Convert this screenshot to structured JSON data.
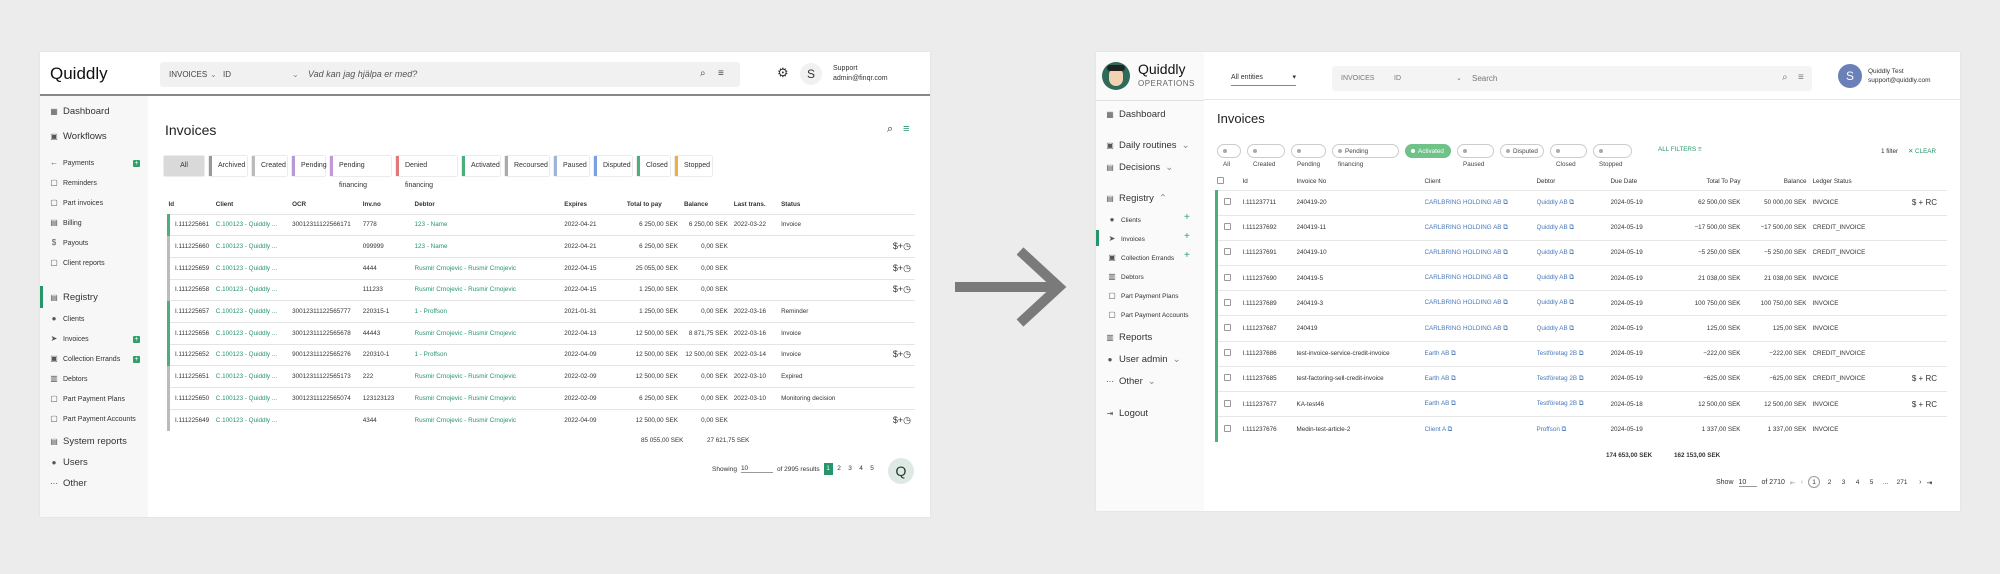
{
  "left": {
    "logo": "Quiddly",
    "search": {
      "type": "INVOICES",
      "field": "ID",
      "placeholder": "Vad kan jag hjälpa er med?"
    },
    "user": {
      "initial": "S",
      "name": "Support",
      "email": "admin@finqr.com"
    },
    "nav": {
      "dashboard": "Dashboard",
      "workflows": "Workflows",
      "payments": "Payments",
      "reminders": "Reminders",
      "part_invoices": "Part invoices",
      "billing": "Billing",
      "payouts": "Payouts",
      "client_reports": "Client reports",
      "registry": "Registry",
      "clients": "Clients",
      "invoices": "Invoices",
      "collection_errands": "Collection Errands",
      "debtors": "Debtors",
      "part_payment_plans": "Part Payment Plans",
      "part_payment_accounts": "Part Payment Accounts",
      "system_reports": "System reports",
      "users": "Users",
      "other": "Other"
    },
    "title": "Invoices",
    "filters": [
      "All",
      "Archived",
      "Created",
      "Pending",
      "Pending financing",
      "Denied financing",
      "Activated",
      "Recoursed",
      "Paused",
      "Disputed",
      "Closed",
      "Stopped"
    ],
    "filter_colors": [
      "#bbbbbb",
      "#999999",
      "#bbbbbb",
      "#b59ad6",
      "#c49ad6",
      "#e07a7a",
      "#4cae7a",
      "#aaaaaa",
      "#a0b4d6",
      "#7aa0e0",
      "#4cae7a",
      "#f0b040"
    ],
    "columns": [
      "Id",
      "Client",
      "OCR",
      "Inv.no",
      "Debtor",
      "Expires",
      "Total to pay",
      "Balance",
      "Last trans.",
      "Status"
    ],
    "rows": [
      {
        "id": "I.111225661",
        "client": "C.100123 - Quiddly ...",
        "ocr": "30012311122566171",
        "inv": "7778",
        "debtor": "123 - Name",
        "expires": "2022-04-21",
        "total": "6 250,00 SEK",
        "balance": "6 250,00 SEK",
        "last": "2022-03-22",
        "status": "Invoice",
        "actions": ""
      },
      {
        "id": "I.111225660",
        "client": "C.100123 - Quiddly ...",
        "ocr": "",
        "inv": "099999",
        "debtor": "123 - Name",
        "expires": "2022-04-21",
        "total": "6 250,00 SEK",
        "balance": "0,00 SEK",
        "last": "",
        "status": "",
        "actions": "$+◷"
      },
      {
        "id": "I.111225659",
        "client": "C.100123 - Quiddly ...",
        "ocr": "",
        "inv": "4444",
        "debtor": "Rusmir Crnojevic - Rusmir Crnojevic",
        "expires": "2022-04-15",
        "total": "25 055,00 SEK",
        "balance": "0,00 SEK",
        "last": "",
        "status": "",
        "actions": "$+◷"
      },
      {
        "id": "I.111225658",
        "client": "C.100123 - Quiddly ...",
        "ocr": "",
        "inv": "111233",
        "debtor": "Rusmir Crnojevic - Rusmir Crnojevic",
        "expires": "2022-04-15",
        "total": "1 250,00 SEK",
        "balance": "0,00 SEK",
        "last": "",
        "status": "",
        "actions": "$+◷"
      },
      {
        "id": "I.111225657",
        "client": "C.100123 - Quiddly ...",
        "ocr": "30012311122565777",
        "inv": "220315-1",
        "debtor": "1 - Proffson",
        "expires": "2021-01-31",
        "total": "1 250,00 SEK",
        "balance": "0,00 SEK",
        "last": "2022-03-16",
        "status": "Reminder",
        "actions": ""
      },
      {
        "id": "I.111225656",
        "client": "C.100123 - Quiddly ...",
        "ocr": "30012311122565678",
        "inv": "44443",
        "debtor": "Rusmir Crnojevic - Rusmir Crnojevic",
        "expires": "2022-04-13",
        "total": "12 500,00 SEK",
        "balance": "8 871,75 SEK",
        "last": "2022-03-16",
        "status": "Invoice",
        "actions": ""
      },
      {
        "id": "I.111225652",
        "client": "C.100123 - Quiddly ...",
        "ocr": "90012311122565276",
        "inv": "220310-1",
        "debtor": "1 - Proffson",
        "expires": "2022-04-09",
        "total": "12 500,00 SEK",
        "balance": "12 500,00 SEK",
        "last": "2022-03-14",
        "status": "Invoice",
        "actions": "$+◷"
      },
      {
        "id": "I.111225651",
        "client": "C.100123 - Quiddly ...",
        "ocr": "30012311122565173",
        "inv": "222",
        "debtor": "Rusmir Crnojevic - Rusmir Crnojevic",
        "expires": "2022-02-09",
        "total": "12 500,00 SEK",
        "balance": "0,00 SEK",
        "last": "2022-03-10",
        "status": "Expired",
        "actions": ""
      },
      {
        "id": "I.111225650",
        "client": "C.100123 - Quiddly ...",
        "ocr": "30012311122565074",
        "inv": "123123123",
        "debtor": "Rusmir Crnojevic - Rusmir Crnojevic",
        "expires": "2022-02-09",
        "total": "6 250,00 SEK",
        "balance": "0,00 SEK",
        "last": "2022-03-10",
        "status": "Monitoring decision",
        "actions": ""
      },
      {
        "id": "I.111225649",
        "client": "C.100123 - Quiddly ...",
        "ocr": "",
        "inv": "4344",
        "debtor": "Rusmir Crnojevic - Rusmir Crnojevic",
        "expires": "2022-04-09",
        "total": "12 500,00 SEK",
        "balance": "0,00 SEK",
        "last": "",
        "status": "",
        "actions": "$+◷"
      }
    ],
    "totals": {
      "total": "85 055,00 SEK",
      "balance": "27 621,75 SEK"
    },
    "pagination": {
      "showing": "Showing",
      "per_page": "10",
      "of": "of 2995 results",
      "pages": [
        "1",
        "2",
        "3",
        "4",
        "5"
      ]
    }
  },
  "right": {
    "logo": "Quiddly",
    "logo_sub": "OPERATIONS",
    "entities": "All entities",
    "search": {
      "type": "INVOICES",
      "field": "ID",
      "placeholder": "Search"
    },
    "user": {
      "initial": "S",
      "name": "Quiddly Test",
      "email": "support@quiddly.com"
    },
    "nav": {
      "dashboard": "Dashboard",
      "daily_routines": "Daily routines",
      "decisions": "Decisions",
      "registry": "Registry",
      "clients": "Clients",
      "invoices": "Invoices",
      "collection_errands": "Collection Errands",
      "debtors": "Debtors",
      "part_payment_plans": "Part Payment Plans",
      "part_payment_accounts": "Part Payment Accounts",
      "reports": "Reports",
      "user_admin": "User admin",
      "other": "Other",
      "logout": "Logout"
    },
    "title": "Invoices",
    "chips": [
      "All",
      "Created",
      "Pending",
      "Pending financing",
      "Activated",
      "Paused",
      "Disputed",
      "Closed",
      "Stopped"
    ],
    "all_filters": "ALL FILTERS",
    "filter_count": "1 filter",
    "clear": "CLEAR",
    "columns": [
      "Id",
      "Invoice No",
      "Client",
      "Debtor",
      "Due Date",
      "Total To Pay",
      "Balance",
      "Ledger Status"
    ],
    "rows": [
      {
        "id": "I.111237711",
        "no": "240419-20",
        "client": "CARLBRING HOLDING AB",
        "debtor": "Quiddly AB",
        "due": "2024-05-19",
        "total": "62 500,00 SEK",
        "balance": "50 000,00 SEK",
        "status": "INVOICE",
        "actions": "$ + RC"
      },
      {
        "id": "I.111237692",
        "no": "240419-11",
        "client": "CARLBRING HOLDING AB",
        "debtor": "Quiddly AB",
        "due": "2024-05-19",
        "total": "−17 500,00 SEK",
        "balance": "−17 500,00 SEK",
        "status": "CREDIT_INVOICE",
        "actions": ""
      },
      {
        "id": "I.111237691",
        "no": "240419-10",
        "client": "CARLBRING HOLDING AB",
        "debtor": "Quiddly AB",
        "due": "2024-05-19",
        "total": "−5 250,00 SEK",
        "balance": "−5 250,00 SEK",
        "status": "CREDIT_INVOICE",
        "actions": ""
      },
      {
        "id": "I.111237690",
        "no": "240419-5",
        "client": "CARLBRING HOLDING AB",
        "debtor": "Quiddly AB",
        "due": "2024-05-19",
        "total": "21 038,00 SEK",
        "balance": "21 038,00 SEK",
        "status": "INVOICE",
        "actions": ""
      },
      {
        "id": "I.111237689",
        "no": "240419-3",
        "client": "CARLBRING HOLDING AB",
        "debtor": "Quiddly AB",
        "due": "2024-05-19",
        "total": "100 750,00 SEK",
        "balance": "100 750,00 SEK",
        "status": "INVOICE",
        "actions": ""
      },
      {
        "id": "I.111237687",
        "no": "240419",
        "client": "CARLBRING HOLDING AB",
        "debtor": "Quiddly AB",
        "due": "2024-05-19",
        "total": "125,00 SEK",
        "balance": "125,00 SEK",
        "status": "INVOICE",
        "actions": ""
      },
      {
        "id": "I.111237686",
        "no": "test-invoice-service-credit-invoice",
        "client": "Earth AB",
        "debtor": "Testföretag 2B",
        "due": "2024-05-19",
        "total": "−222,00 SEK",
        "balance": "−222,00 SEK",
        "status": "CREDIT_INVOICE",
        "actions": ""
      },
      {
        "id": "I.111237685",
        "no": "test-factoring-sell-credit-invoice",
        "client": "Earth AB",
        "debtor": "Testföretag 2B",
        "due": "2024-05-19",
        "total": "−625,00 SEK",
        "balance": "−625,00 SEK",
        "status": "CREDIT_INVOICE",
        "actions": "$ + RC"
      },
      {
        "id": "I.111237677",
        "no": "KA-test46",
        "client": "Earth AB",
        "debtor": "Testföretag 2B",
        "due": "2024-05-18",
        "total": "12 500,00 SEK",
        "balance": "12 500,00 SEK",
        "status": "INVOICE",
        "actions": "$ + RC"
      },
      {
        "id": "I.111237676",
        "no": "Medin-test-article-2",
        "client": "Client A",
        "debtor": "Proffson",
        "due": "2024-05-19",
        "total": "1 337,00 SEK",
        "balance": "1 337,00 SEK",
        "status": "INVOICE",
        "actions": ""
      }
    ],
    "totals": {
      "total": "174 653,00 SEK",
      "balance": "162 153,00 SEK"
    },
    "pagination": {
      "show": "Show",
      "per_page": "10",
      "of": "of 2710",
      "pages": [
        "1",
        "2",
        "3",
        "4",
        "5",
        "...",
        "271"
      ]
    }
  },
  "accent": "#27956a"
}
